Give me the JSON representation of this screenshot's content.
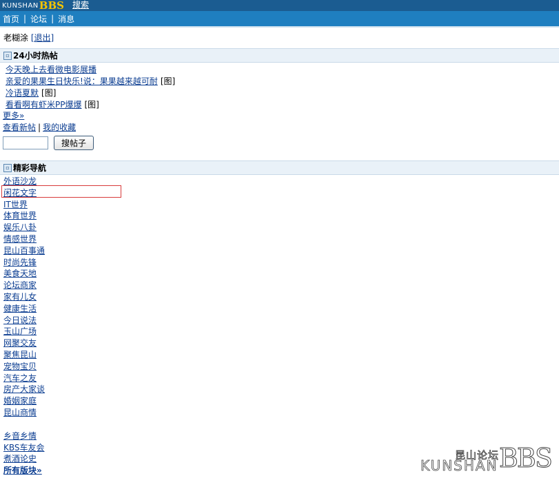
{
  "header": {
    "logo_text": "KUNSHAN",
    "logo_mark": "BBS",
    "search_link": "搜索"
  },
  "nav": {
    "items": [
      "首页",
      "论坛",
      "消息"
    ],
    "separator": "|"
  },
  "user": {
    "name": "老糊涂",
    "logout": "[退出]"
  },
  "hot": {
    "title": "24小时热帖",
    "items": [
      {
        "title": "今天晚上去看微电影展播",
        "tag": ""
      },
      {
        "title": "亲爱的果果生日快乐!说：果果越来越可耐",
        "tag": "[图]"
      },
      {
        "title": "冷语夏默",
        "tag": "[图]"
      },
      {
        "title": "看看啊有虾米PP爆爆",
        "tag": "[图]"
      }
    ],
    "more": "更多»",
    "view_new": "查看新帖",
    "separator": "|",
    "my_favorites": "我的收藏",
    "search_button": "搜帖子"
  },
  "featured": {
    "title": "精彩导航",
    "items": [
      "外语沙龙",
      "闲花文字",
      "IT世界",
      "体育世界",
      "娱乐八卦",
      "情感世界",
      "昆山百事通",
      "时尚先锋",
      "美食天地",
      "论坛商家",
      "家有儿女",
      "健康生活",
      "今日说法",
      "玉山广场",
      "网聚交友",
      "聚焦昆山",
      "宠物宝贝",
      "汽车之友",
      "房产大家谈",
      "婚姻家庭",
      "昆山商情"
    ],
    "extra_items": [
      "乡音乡情",
      "KBS车友会",
      "煮酒论史"
    ],
    "all_boards": "所有版块»"
  },
  "watermark": {
    "chinese": "昆山论坛",
    "kunshan": "KUNSHAN",
    "bbs": "BBS"
  },
  "colors": {
    "topbar": "#1b5c91",
    "navbar": "#1f7fc0",
    "link": "#0b3d91",
    "section_bg": "#e9f1f8",
    "highlight": "#d83a3a"
  }
}
